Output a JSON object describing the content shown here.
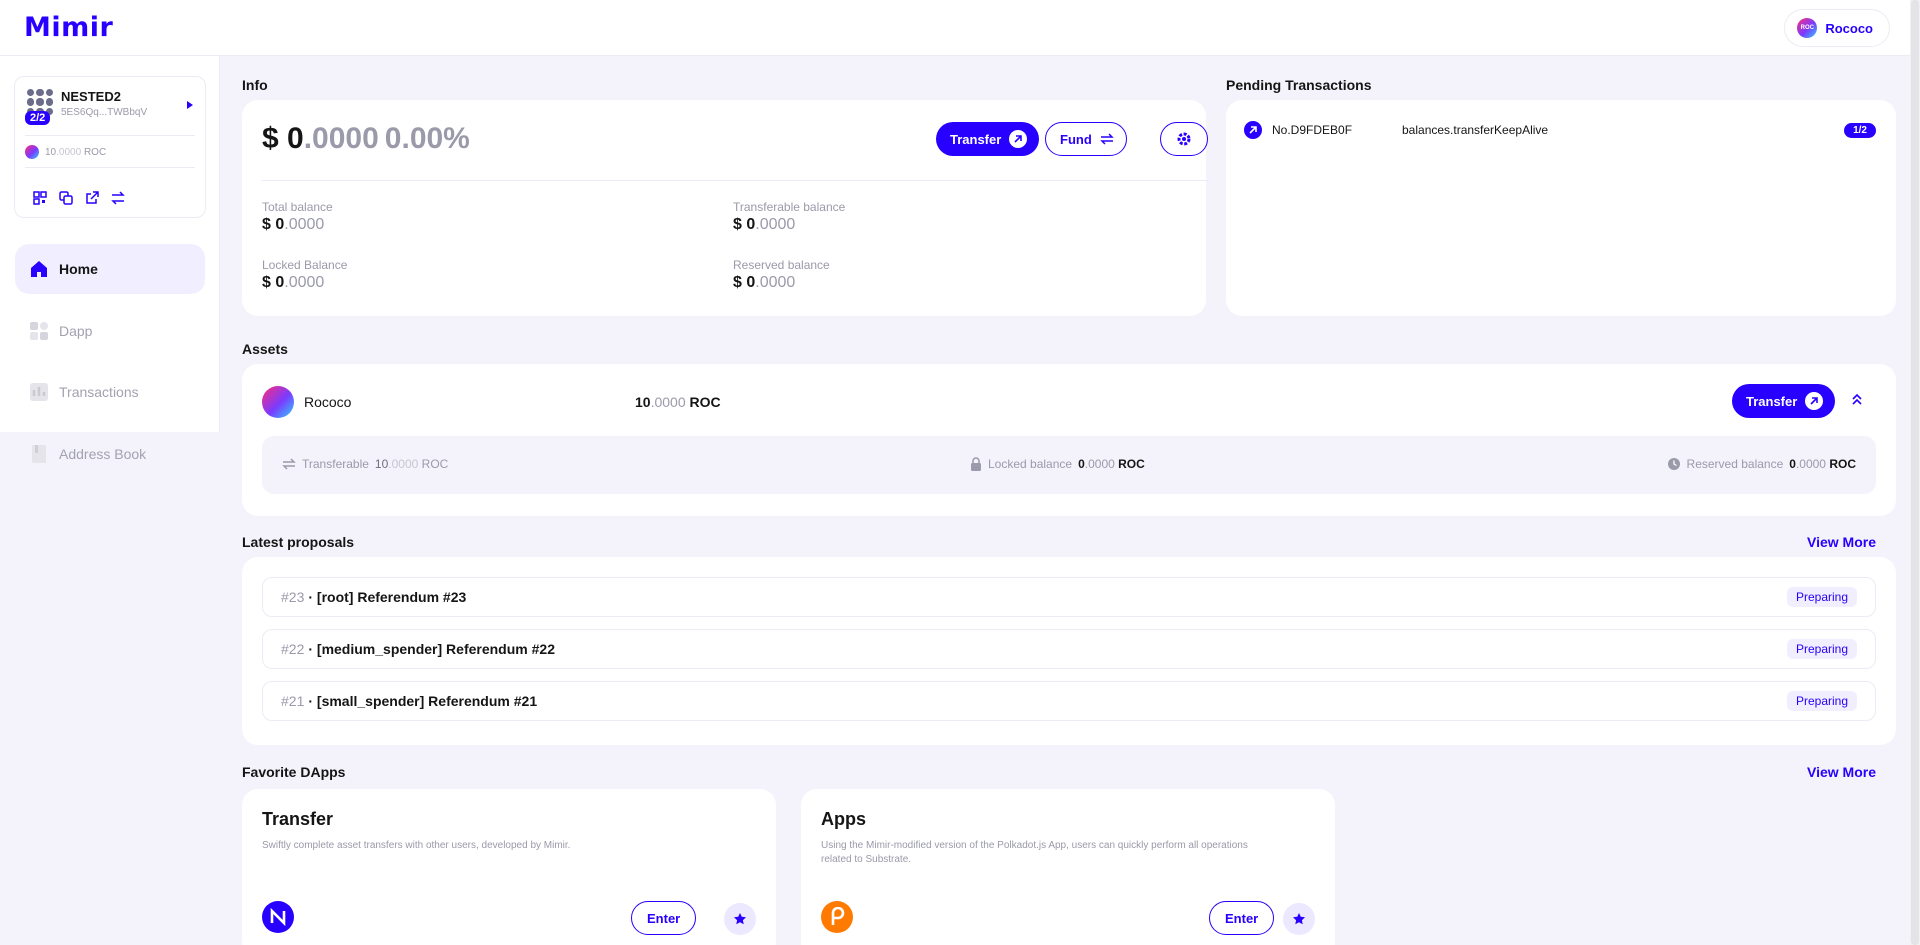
{
  "header": {
    "logo": "Mimir",
    "network": "Rococo",
    "network_icon_text": "ROC"
  },
  "account": {
    "name": "NESTED2",
    "address": "5ES6Qq...TWBbqV",
    "threshold": "2/2",
    "balance_int": "10",
    "balance_dec": ".0000",
    "balance_unit": "ROC"
  },
  "sidebar": {
    "items": [
      {
        "label": "Home",
        "icon": "home-icon"
      },
      {
        "label": "Dapp",
        "icon": "apps-icon"
      },
      {
        "label": "Transactions",
        "icon": "transactions-icon"
      },
      {
        "label": "Address Book",
        "icon": "book-icon"
      }
    ]
  },
  "info": {
    "title": "Info",
    "total_prefix": "$ 0",
    "total_dec": ".0000",
    "total_pct": "0.00%",
    "transfer_label": "Transfer",
    "fund_label": "Fund",
    "balances": [
      {
        "label": "Total balance",
        "int": "$ 0",
        "dec": ".0000"
      },
      {
        "label": "Transferable balance",
        "int": "$ 0",
        "dec": ".0000"
      },
      {
        "label": "Locked Balance",
        "int": "$ 0",
        "dec": ".0000"
      },
      {
        "label": "Reserved balance",
        "int": "$ 0",
        "dec": ".0000"
      }
    ]
  },
  "pending": {
    "title": "Pending Transactions",
    "tx": {
      "no": "No.D9FDEB0F",
      "method": "balances.transferKeepAlive",
      "count": "1/2"
    }
  },
  "assets": {
    "title": "Assets",
    "name": "Rococo",
    "amount_int": "10",
    "amount_dec": ".0000",
    "unit": "ROC",
    "transfer_label": "Transfer",
    "transferable_label": "Transferable",
    "transferable_int": "10",
    "transferable_dec": ".0000",
    "locked_label": "Locked balance",
    "locked_int": "0",
    "locked_dec": ".0000",
    "reserved_label": "Reserved balance",
    "reserved_int": "0",
    "reserved_dec": ".0000"
  },
  "proposals": {
    "title": "Latest proposals",
    "view_more": "View More",
    "items": [
      {
        "id": "#23",
        "title": "· [root] Referendum #23",
        "status": "Preparing"
      },
      {
        "id": "#22",
        "title": "· [medium_spender] Referendum #22",
        "status": "Preparing"
      },
      {
        "id": "#21",
        "title": "· [small_spender] Referendum #21",
        "status": "Preparing"
      }
    ]
  },
  "dapps": {
    "title": "Favorite DApps",
    "view_more": "View More",
    "items": [
      {
        "name": "Transfer",
        "desc": "Swiftly complete asset transfers with other users, developed by Mimir.",
        "enter": "Enter",
        "logo_color": "#2700ff"
      },
      {
        "name": "Apps",
        "desc": "Using the Mimir-modified version of the Polkadot.js App, users can quickly perform all operations related to Substrate.",
        "enter": "Enter",
        "logo_color": "#ff7a00"
      }
    ]
  },
  "colors": {
    "accent": "#2700ff",
    "accent_soft": "#f1efff",
    "muted": "#9a9aaa"
  }
}
